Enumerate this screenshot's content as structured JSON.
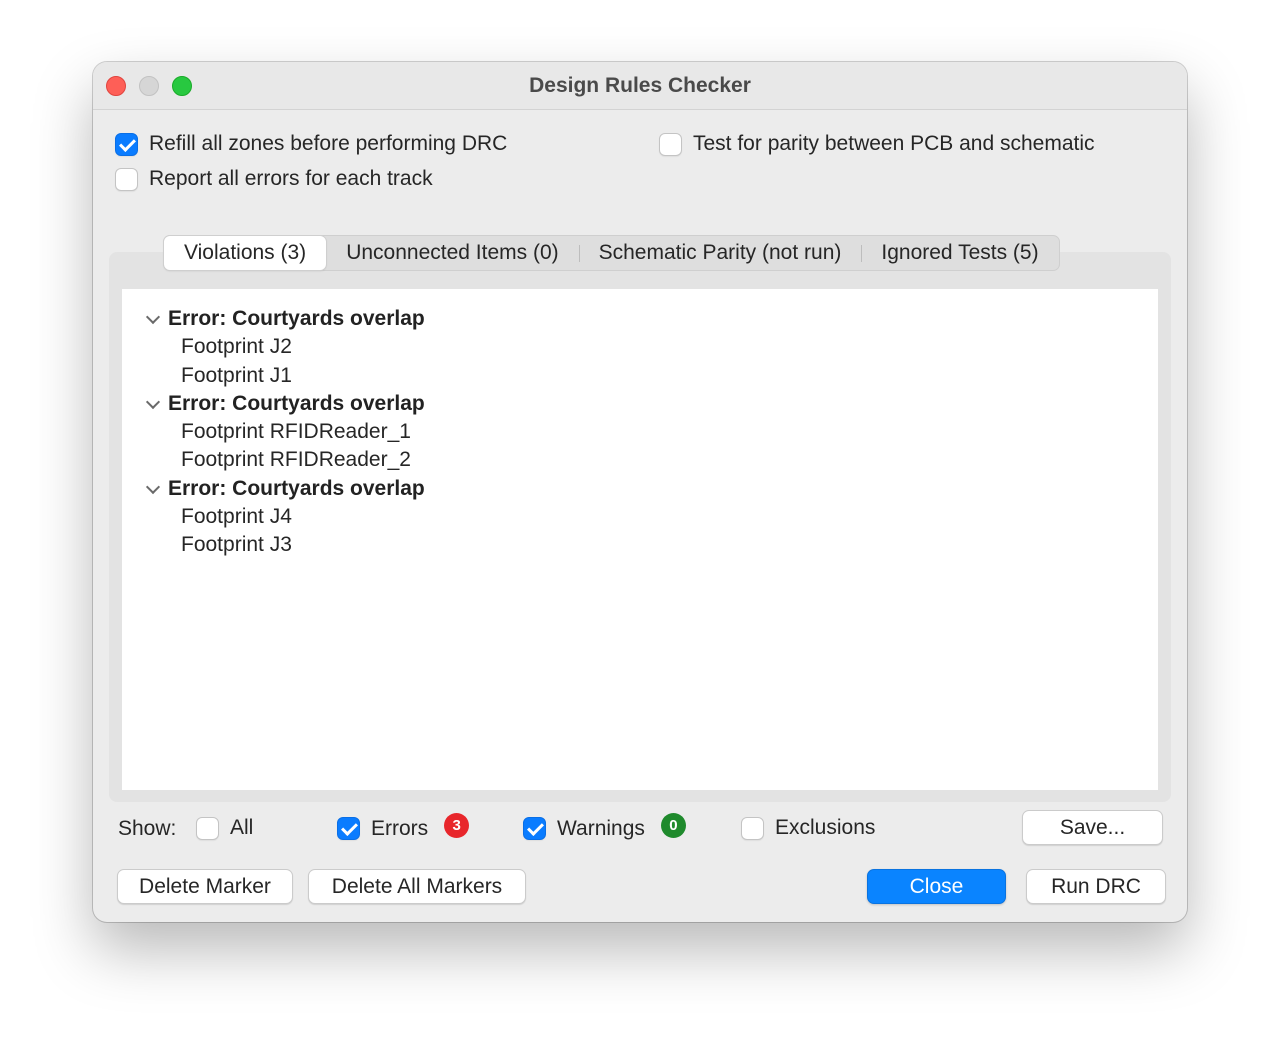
{
  "window": {
    "title": "Design Rules Checker"
  },
  "options": {
    "refill_zones": {
      "label": "Refill all zones before performing DRC",
      "checked": true
    },
    "report_all_errors": {
      "label": "Report all errors for each track",
      "checked": false
    },
    "test_parity": {
      "label": "Test for parity between PCB and schematic",
      "checked": false
    }
  },
  "tabs": [
    {
      "label": "Violations (3)",
      "active": true
    },
    {
      "label": "Unconnected Items (0)",
      "active": false
    },
    {
      "label": "Schematic Parity (not run)",
      "active": false
    },
    {
      "label": "Ignored Tests (5)",
      "active": false
    }
  ],
  "violations": [
    {
      "title": "Error: Courtyards overlap",
      "items": [
        "Footprint J2",
        "Footprint J1"
      ]
    },
    {
      "title": "Error: Courtyards overlap",
      "items": [
        "Footprint RFIDReader_1",
        "Footprint RFIDReader_2"
      ]
    },
    {
      "title": "Error: Courtyards overlap",
      "items": [
        "Footprint J4",
        "Footprint J3"
      ]
    }
  ],
  "filters": {
    "show_label": "Show:",
    "all": {
      "label": "All",
      "checked": false
    },
    "errors": {
      "label": "Errors",
      "checked": true,
      "count": "3",
      "color": "#e8262b"
    },
    "warnings": {
      "label": "Warnings",
      "checked": true,
      "count": "0",
      "color": "#1f8a2c"
    },
    "exclusions": {
      "label": "Exclusions",
      "checked": false
    }
  },
  "buttons": {
    "save": "Save...",
    "delete_marker": "Delete Marker",
    "delete_all_markers": "Delete All Markers",
    "close": "Close",
    "run_drc": "Run DRC"
  },
  "colors": {
    "accent": "#0a84ff"
  }
}
